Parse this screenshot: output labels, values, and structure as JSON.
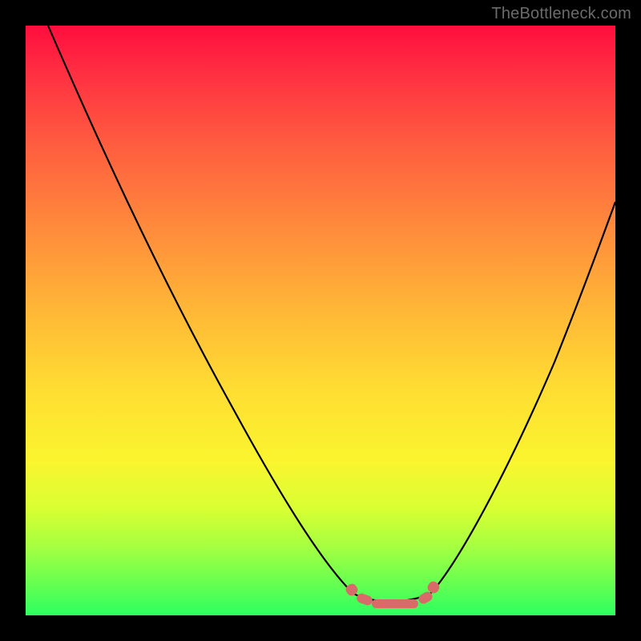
{
  "watermark": "TheBottleneck.com",
  "colors": {
    "frame": "#000000",
    "gradient_top": "#ff0d3d",
    "gradient_bottom": "#2cff60",
    "curve": "#000000",
    "trough": "#d86a6a",
    "watermark_text": "#6b6b6b"
  },
  "chart_data": {
    "type": "line",
    "title": "",
    "xlabel": "",
    "ylabel": "",
    "xlim": [
      0,
      100
    ],
    "ylim": [
      0,
      100
    ],
    "grid": false,
    "legend": false,
    "x": [
      4,
      10,
      16,
      22,
      28,
      34,
      40,
      46,
      52,
      55,
      58,
      62,
      66,
      70,
      76,
      82,
      88,
      94,
      100
    ],
    "values": [
      100,
      90,
      80,
      70,
      60,
      50,
      40,
      30,
      18,
      8,
      3,
      1,
      1,
      2,
      8,
      18,
      30,
      44,
      60
    ],
    "optimal_range_x": [
      55,
      70
    ],
    "optimal_range_y": [
      0,
      5
    ],
    "background_metric": {
      "description": "vertical color gradient encodes bottleneck severity",
      "top_value": 100,
      "bottom_value": 0
    }
  }
}
